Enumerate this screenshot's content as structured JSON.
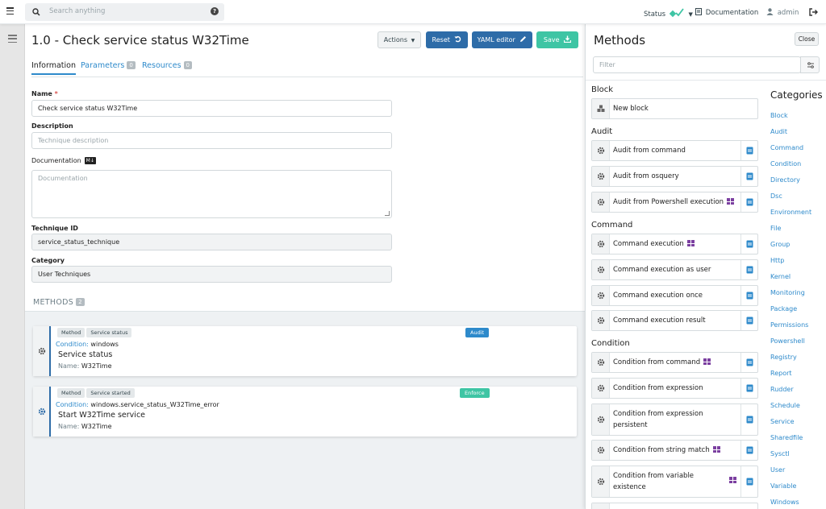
{
  "topnav": {
    "search_placeholder": "Search anything",
    "help": "?",
    "status_label": "Status",
    "documentation_label": "Documentation",
    "user_label": "admin"
  },
  "main": {
    "title": "1.0 - Check service status W32Time",
    "buttons": {
      "actions": "Actions",
      "reset": "Reset",
      "yaml": "YAML editor",
      "save": "Save"
    },
    "tabs": [
      {
        "label": "Information"
      },
      {
        "label": "Parameters",
        "count": "0"
      },
      {
        "label": "Resources",
        "count": "0"
      }
    ],
    "form": {
      "name_label": "Name",
      "required_mark": "*",
      "name_value": "Check service status W32Time",
      "description_label": "Description",
      "description_placeholder": "Technique description",
      "documentation_label": "Documentation",
      "markdown_badge": "M↓",
      "documentation_placeholder": "Documentation",
      "technique_id_label": "Technique ID",
      "technique_id_value": "service_status_technique",
      "category_label": "Category",
      "category_value": "User Techniques"
    },
    "methods_header": {
      "label": "METHODS",
      "count": "2"
    },
    "methods": [
      {
        "chips": [
          "Method",
          "Service status"
        ],
        "tag": "Audit",
        "tag_color": "#2e8acb",
        "condition_key": "Condition:",
        "condition_value": "windows",
        "name": "Service status",
        "sub_key": "Name:",
        "sub_value": "W32Time"
      },
      {
        "chips": [
          "Method",
          "Service started"
        ],
        "tag": "Enforce",
        "tag_color": "#3ec5a4",
        "condition_key": "Condition:",
        "condition_value": "windows.service_status_W32Time_error",
        "name": "Start W32Time service",
        "sub_key": "Name:",
        "sub_value": "W32Time"
      }
    ]
  },
  "panel": {
    "title": "Methods",
    "close_label": "Close",
    "filter_placeholder": "Filter",
    "groups": [
      {
        "title": "Block",
        "items": [
          {
            "name": "New block"
          }
        ]
      },
      {
        "title": "Audit",
        "items": [
          {
            "name": "Audit from command"
          },
          {
            "name": "Audit from osquery"
          },
          {
            "name": "Audit from Powershell execution",
            "windows": true
          }
        ]
      },
      {
        "title": "Command",
        "items": [
          {
            "name": "Command execution",
            "windows": true
          },
          {
            "name": "Command execution as user"
          },
          {
            "name": "Command execution once"
          },
          {
            "name": "Command execution result"
          }
        ]
      },
      {
        "title": "Condition",
        "items": [
          {
            "name": "Condition from command",
            "windows": true
          },
          {
            "name": "Condition from expression"
          },
          {
            "name": "Condition from expression persistent"
          },
          {
            "name": "Condition from string match",
            "windows": true
          },
          {
            "name": "Condition from variable existence",
            "windows": true
          }
        ]
      }
    ],
    "categories_title": "Categories",
    "categories": [
      "Block",
      "Audit",
      "Command",
      "Condition",
      "Directory",
      "Dsc",
      "Environment",
      "File",
      "Group",
      "Http",
      "Kernel",
      "Monitoring",
      "Package",
      "Permissions",
      "Powershell",
      "Registry",
      "Report",
      "Rudder",
      "Schedule",
      "Service",
      "Sharedfile",
      "Sysctl",
      "User",
      "Variable",
      "Windows"
    ]
  },
  "colors": {
    "primary": "#2e6ca8",
    "link": "#2e8acb",
    "success": "#3ec5a4",
    "windows": "#7b3fa0"
  }
}
